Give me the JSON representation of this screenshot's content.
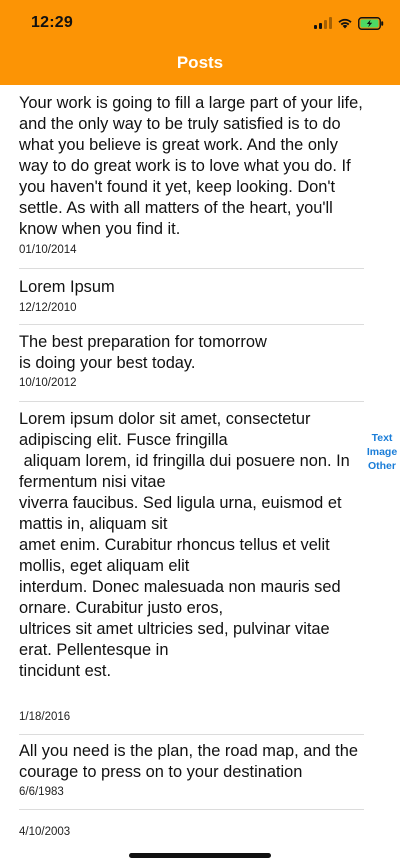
{
  "status_bar": {
    "time": "12:29"
  },
  "nav": {
    "title": "Posts",
    "accent_color": "#fc9405"
  },
  "posts": [
    {
      "text": "Your work is going to fill a large part of your life, and the only way to be truly satisfied is to do what you believe is great work. And the only way to do great work is to love what you do. If you haven't found it yet, keep looking. Don't settle. As with all matters of the heart, you'll know when you find it.",
      "date": "01/10/2014"
    },
    {
      "text": "Lorem Ipsum",
      "date": "12/12/2010"
    },
    {
      "text": "The best preparation for tomorrow\nis doing your best today.",
      "date": "10/10/2012"
    },
    {
      "text": "Lorem ipsum dolor sit amet, consectetur adipiscing elit. Fusce fringilla\n aliquam lorem, id fringilla dui posuere non. In fermentum nisi vitae\nviverra faucibus. Sed ligula urna, euismod et mattis in, aliquam sit\namet enim. Curabitur rhoncus tellus et velit mollis, eget aliquam elit\ninterdum. Donec malesuada non mauris sed ornare. Curabitur justo eros,\nultrices sit amet ultricies sed, pulvinar vitae erat. Pellentesque in\ntincidunt est.",
      "date": "1/18/2016"
    },
    {
      "text": "All you need is the plan, the road map, and the courage to press on to your destination",
      "date": "6/6/1983"
    },
    {
      "text": "",
      "date": "4/10/2003"
    }
  ],
  "section_index": [
    "Text",
    "Image",
    "Other"
  ],
  "index_color": "#1a7dd8"
}
